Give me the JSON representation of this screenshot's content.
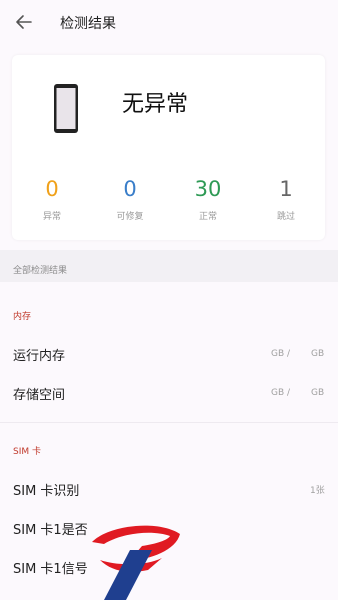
{
  "header": {
    "title": "检测结果"
  },
  "summary": {
    "status": "无异常",
    "stats": [
      {
        "value": "0",
        "label": "异常",
        "color": "#f0a11a"
      },
      {
        "value": "0",
        "label": "可修复",
        "color": "#3a7ec9"
      },
      {
        "value": "30",
        "label": "正常",
        "color": "#2e9a55"
      },
      {
        "value": "1",
        "label": "跳过",
        "color": "#666666"
      }
    ]
  },
  "all_results_label": "全部检测结果",
  "sections": {
    "memory": {
      "label": "内存",
      "rows": [
        {
          "label": "运行内存",
          "value_a": "GB /",
          "value_b": "GB"
        },
        {
          "label": "存储空间",
          "value_a": "GB /",
          "value_b": "GB"
        }
      ]
    },
    "sim": {
      "label": "SIM 卡",
      "rows": [
        {
          "label": "SIM 卡识别",
          "value": "1张"
        },
        {
          "label": "SIM 卡1是否"
        },
        {
          "label": "SIM 卡1信号"
        }
      ]
    }
  }
}
